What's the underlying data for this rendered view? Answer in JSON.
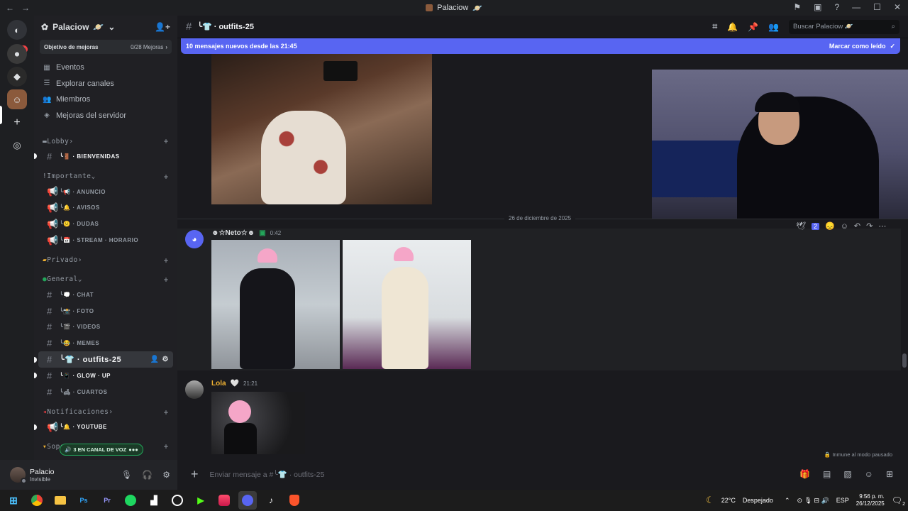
{
  "window": {
    "title": "Palaciow",
    "title_emoji": "🪐"
  },
  "rail": {
    "unread_badge": "153"
  },
  "server": {
    "name": "Palaciow",
    "name_emoji": "🪐",
    "boost_label": "Objetivo de mejoras",
    "boost_progress": "0/28 Mejoras",
    "nav": [
      {
        "icon": "calendar-icon",
        "label": "Eventos"
      },
      {
        "icon": "browse-icon",
        "label": "Explorar canales"
      },
      {
        "icon": "members-icon",
        "label": "Miembros"
      },
      {
        "icon": "boost-icon",
        "label": "Mejoras del servidor"
      }
    ]
  },
  "categories": {
    "lobby": "Lobby",
    "importante": "Importante",
    "privado": "Privado",
    "general": "General",
    "notificaciones": "Notificaciones",
    "soporte": "Soporte"
  },
  "channels": {
    "bienvenidas": "╰🚪 · BIENVENIDAS",
    "anuncio": "╰📢 · ANUNCIO",
    "avisos": "╰🔔 · AVISOS",
    "dudas": "╰😕 · DUDAS",
    "stream": "╰📅 · STREAM · HORARIO",
    "chat": "╰💭 · CHAT",
    "foto": "╰📸 · FOTO",
    "videos": "╰🎬 · VIDEOS",
    "memes": "╰😂 · MEMES",
    "outfits": "╰👕 · outfits-25",
    "glowup": "╰📱 · GLOW · UP",
    "cuartos": "╰🛋 · CUARTOS",
    "youtube": "╰🔔 · YOUTUBE"
  },
  "voice_pill": "3 EN CANAL DE VOZ",
  "user": {
    "name": "Palacio",
    "status": "Invisible"
  },
  "header": {
    "channel": "╰👕 · outfits-25",
    "search_placeholder": "Buscar Palaciow 🪐"
  },
  "new_messages": {
    "text": "10 mensajes nuevos desde las 21:45",
    "mark_read": "Marcar como leído"
  },
  "date_divider": "26 de diciembre de 2025",
  "messages": [
    {
      "author": "☻☆Neto☆☻",
      "time": "0:42",
      "author_color": "#f2f3f5"
    },
    {
      "author": "Lola",
      "badge": "🤍",
      "time": "21:21",
      "author_color": "#f0b232"
    }
  ],
  "reactions": {
    "count": "2"
  },
  "paused_note": "Inmune al modo pausado",
  "composer": {
    "placeholder": "Enviar mensaje a #╰👕 · outfits-25"
  },
  "taskbar": {
    "weather_temp": "22°C",
    "weather_desc": "Despejado",
    "lang": "ESP",
    "time": "9:56 p. m.",
    "date": "26/12/2025",
    "notif_count": "2",
    "apps": [
      "chrome-icon",
      "files-icon",
      "photoshop-icon",
      "premiere-icon",
      "spotify-icon",
      "audio-icon",
      "obs-icon",
      "kick-icon",
      "app-icon",
      "discord-icon",
      "tiktok-icon",
      "brave-icon"
    ]
  }
}
